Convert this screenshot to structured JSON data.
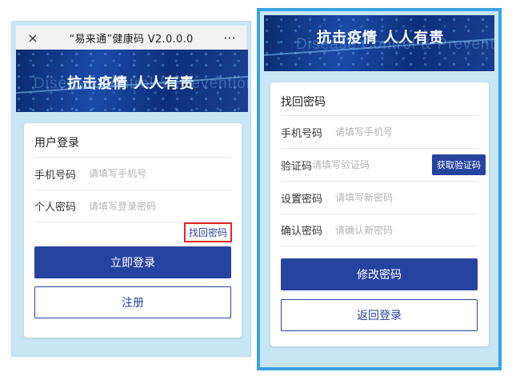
{
  "left_screen": {
    "titlebar": {
      "title": "“易来通”健康码 V2.0.0.0",
      "close_icon": "×",
      "more_icon": "···"
    },
    "banner": {
      "watermark": "Disease Control & Prevention",
      "slogan": "抗击疫情  人人有责"
    },
    "login": {
      "title": "用户登录",
      "phone_label": "手机号码",
      "phone_placeholder": "请填写手机号",
      "password_label": "个人密码",
      "password_placeholder": "请填写登录密码",
      "forgot_link": "找回密码",
      "login_button": "立即登录",
      "register_button": "注册"
    }
  },
  "right_screen": {
    "banner": {
      "watermark": "Disease Control & Prevention",
      "slogan": "抗击疫情  人人有责"
    },
    "recover": {
      "title": "找回密码",
      "phone_label": "手机号码",
      "phone_placeholder": "请填写手机号",
      "code_label": "验证码",
      "code_placeholder": "请填写验证码",
      "get_code_button": "获取验证码",
      "new_password_label": "设置密码",
      "new_password_placeholder": "请填写新密码",
      "confirm_label": "确认密码",
      "confirm_placeholder": "请确认新密码",
      "submit_button": "修改密码",
      "back_button": "返回登录"
    }
  }
}
